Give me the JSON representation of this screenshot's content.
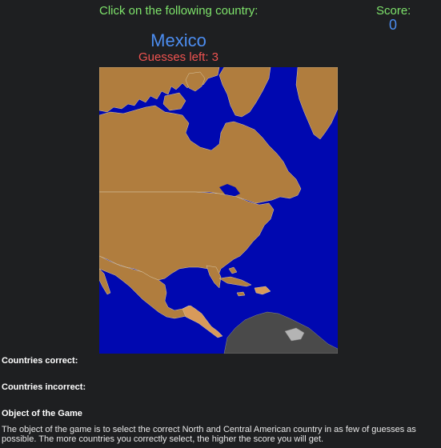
{
  "header": {
    "prompt": "Click on the following country:",
    "score_label": "Score:",
    "score_value": "0"
  },
  "game": {
    "target_country": "Mexico",
    "guesses_left": "Guesses left: 3"
  },
  "map": {
    "colors": {
      "ocean": "#0008b0",
      "land": "#b07d3e",
      "central_america_highlight": "#d89a5a",
      "south_america": "#4a4a4a",
      "border": "#d8c8a8"
    }
  },
  "panels": {
    "countries_correct_label": "Countries correct:",
    "countries_incorrect_label": "Countries incorrect:",
    "object_heading": "Object of the Game",
    "object_text": "The object of the game is to select the correct North and Central American country in as few of guesses as possible. The more countries you correctly select, the higher the score you will get."
  }
}
